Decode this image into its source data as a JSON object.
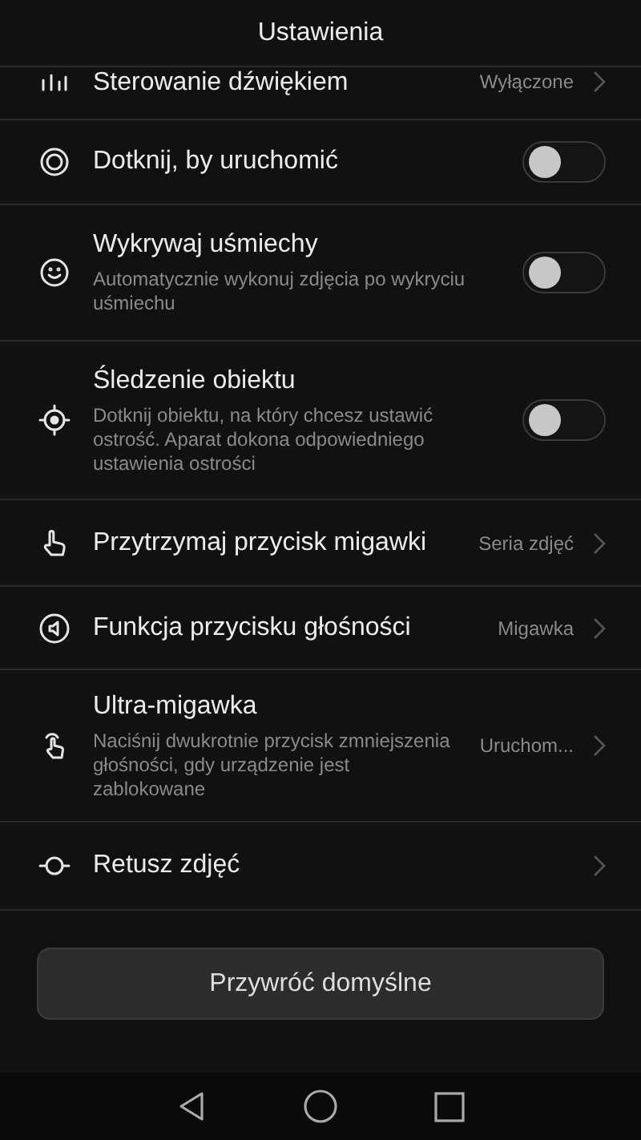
{
  "header": {
    "title": "Ustawienia"
  },
  "rows": [
    {
      "kind": "nav",
      "title": "Sterowanie dźwiękiem",
      "value": "Wyłączone"
    },
    {
      "kind": "toggle",
      "title": "Dotknij, by uruchomić",
      "on": false
    },
    {
      "kind": "toggle",
      "title": "Wykrywaj uśmiechy",
      "description": "Automatycznie wykonuj zdjęcia po wykryciu uśmiechu",
      "on": false
    },
    {
      "kind": "toggle",
      "title": "Śledzenie obiektu",
      "description": "Dotknij obiektu, na który chcesz ustawić ostrość. Aparat dokona odpowiedniego ustawienia ostrości",
      "on": false
    },
    {
      "kind": "nav",
      "title": "Przytrzymaj przycisk migawki",
      "value": "Seria zdjęć"
    },
    {
      "kind": "nav",
      "title": "Funkcja przycisku głośności",
      "value": "Migawka"
    },
    {
      "kind": "nav",
      "title": "Ultra-migawka",
      "description": "Naciśnij dwukrotnie przycisk zmniejszenia głośności, gdy urządzenie jest zablokowane",
      "value": "Uruchom..."
    },
    {
      "kind": "nav",
      "title": "Retusz zdjęć"
    }
  ],
  "reset_button": "Przywróć domyślne"
}
